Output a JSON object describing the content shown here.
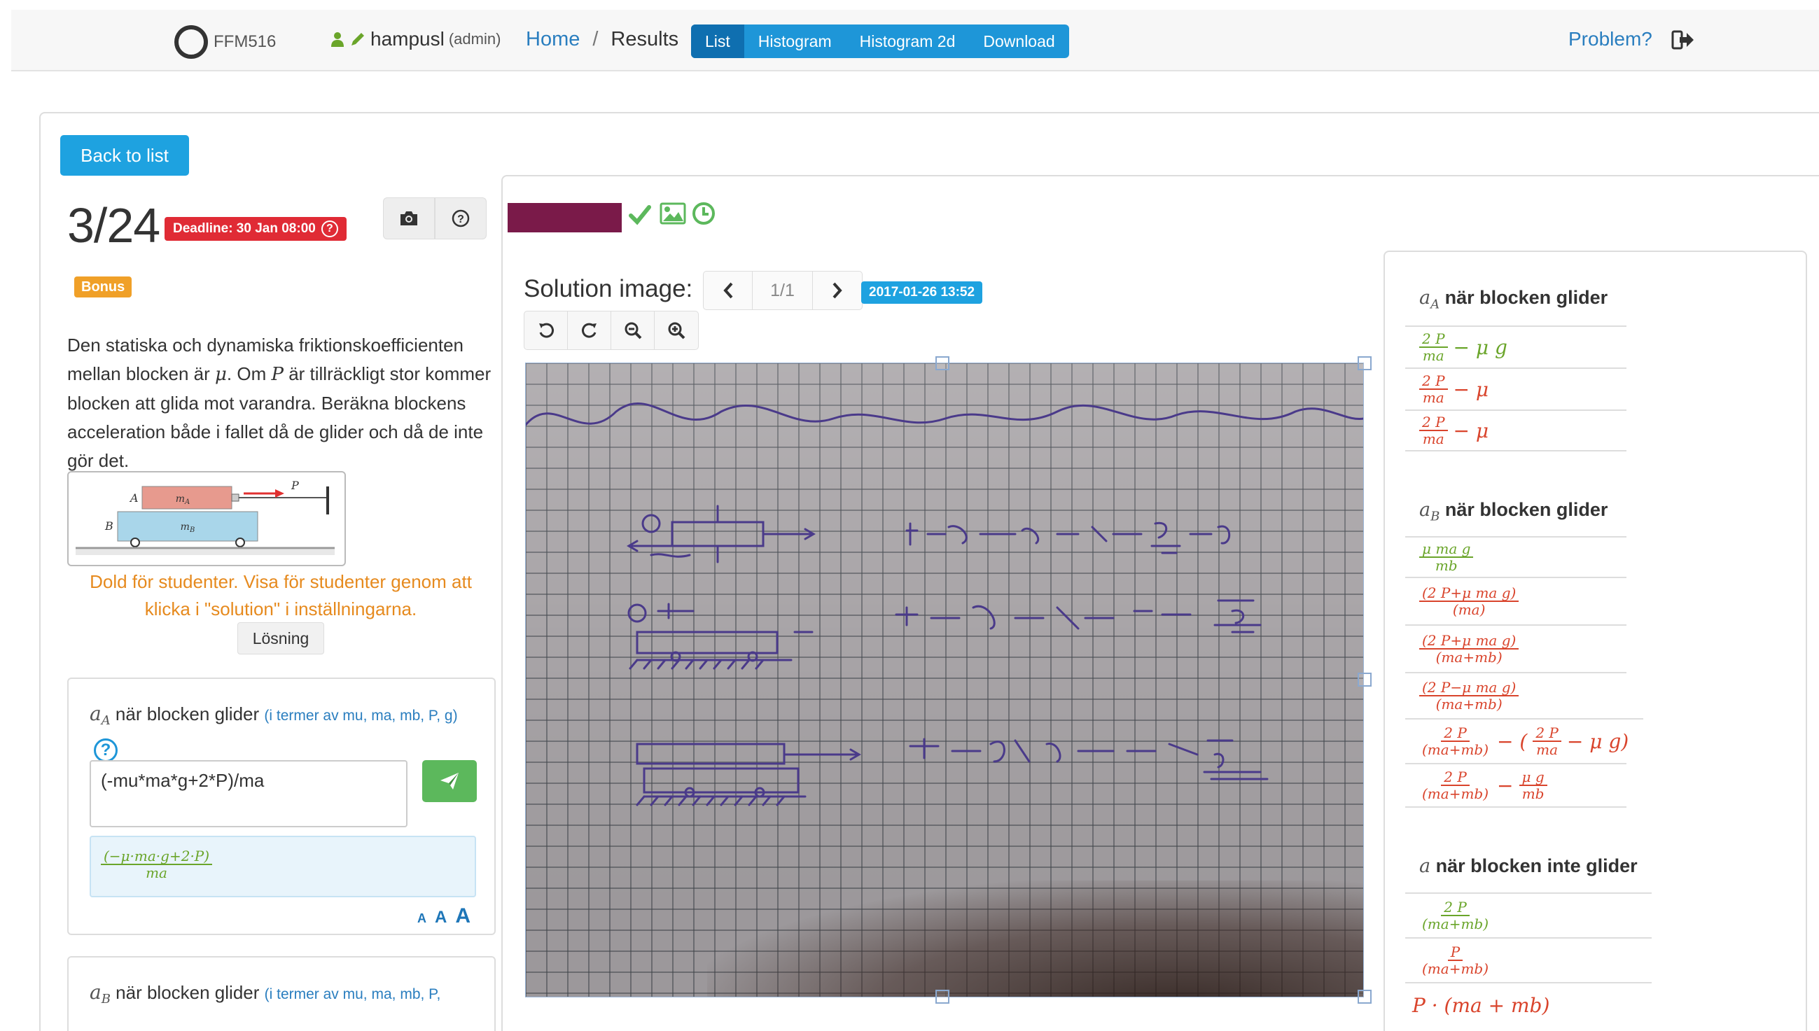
{
  "nav": {
    "course_code": "FFM516",
    "username": "hampusl",
    "role": "(admin)",
    "breadcrumb_home": "Home",
    "breadcrumb_sep": "/",
    "breadcrumb_current": "Results",
    "tabs": [
      {
        "label": "List",
        "active": true
      },
      {
        "label": "Histogram",
        "active": false
      },
      {
        "label": "Histogram 2d",
        "active": false
      },
      {
        "label": "Download",
        "active": false
      }
    ],
    "problem_link": "Problem?"
  },
  "left": {
    "back_label": "Back to list",
    "counter": "3/24",
    "deadline": "Deadline: 30 Jan 08:00",
    "deadline_help": "?",
    "bonus": "Bonus",
    "problem_text_parts": [
      "Den statiska och dynamiska friktionskoefficienten mellan blocken är ",
      "μ",
      ". Om ",
      "P",
      " är tillräckligt stor kommer blocken att glida mot varandra. Beräkna blockens acceleration både i fallet då de glider och då de inte gör det."
    ],
    "figure_labels": {
      "a": "A",
      "b": "B",
      "ma": "m",
      "ma_sub": "A",
      "mb": "m",
      "mb_sub": "B",
      "p": "P"
    },
    "hidden_note": "Dold för studenter. Visa för studenter genom att klicka i \"solution\" i inställningarna.",
    "losning_label": "Lösning",
    "question1": {
      "var": "a",
      "sub": "A",
      "title": " när blocken glider ",
      "hint": "(i termer av mu, ma, mb, P, g)",
      "help": "?",
      "answer": "(-mu*ma*g+2*P)/ma",
      "preview_num": "(−μ·ma·g+2·P)",
      "preview_den": "ma",
      "font_sizes": [
        "A",
        "A",
        "A"
      ]
    },
    "question2": {
      "var": "a",
      "sub": "B",
      "title": " när blocken glider ",
      "hint": "(i termer av mu, ma, mb, P,"
    }
  },
  "middle": {
    "solution_label": "Solution image:",
    "page": "1/1",
    "timestamp": "2017-01-26 13:52",
    "accent_student": "#7a1a49"
  },
  "right": {
    "groups": [
      {
        "var": "a",
        "sub": "A",
        "title": " när blocken glider",
        "answers": [
          {
            "num": "2 P",
            "den": "ma",
            "tail": "− μ g",
            "color": "green"
          },
          {
            "num": "2 P",
            "den": "ma",
            "tail": "− μ",
            "color": "red"
          },
          {
            "num": "2 P",
            "den": "ma",
            "tail": "− μ",
            "color": "red"
          }
        ]
      },
      {
        "var": "a",
        "sub": "B",
        "title": " när blocken glider",
        "answers": [
          {
            "num": "μ ma g",
            "den": "mb",
            "tail": "",
            "color": "green"
          },
          {
            "num": "(2 P+μ ma g)",
            "den": "(ma)",
            "tail": "",
            "color": "red"
          },
          {
            "num": "(2 P+μ ma g)",
            "den": "(ma+mb)",
            "tail": "",
            "color": "red"
          },
          {
            "num": "(2 P−μ ma g)",
            "den": "(ma+mb)",
            "tail": "",
            "color": "red"
          },
          {
            "num": "2 P",
            "den": "(ma+mb)",
            "tail": "− (",
            "tail2_num": "2 P",
            "tail2_den": "ma",
            "tail3": "− μ g)",
            "color": "red"
          },
          {
            "num": "2 P",
            "den": "(ma+mb)",
            "tail": "−",
            "tail2_num": "μ g",
            "tail2_den": "mb",
            "tail3": "",
            "color": "red"
          }
        ]
      },
      {
        "var": "a",
        "sub": "",
        "title": " när blocken inte glider",
        "answers": [
          {
            "num": "2 P",
            "den": "(ma+mb)",
            "tail": "",
            "color": "green"
          },
          {
            "num": "P",
            "den": "(ma+mb)",
            "tail": "",
            "color": "red"
          },
          {
            "expr": "P · (ma + mb)",
            "color": "red"
          }
        ]
      }
    ]
  },
  "colors": {
    "primary": "#1e96d8",
    "deadline": "#e02b35",
    "bonus": "#f0a028",
    "correct": "#6aa52a",
    "wrong": "#d9442c",
    "send": "#5cb85c"
  }
}
